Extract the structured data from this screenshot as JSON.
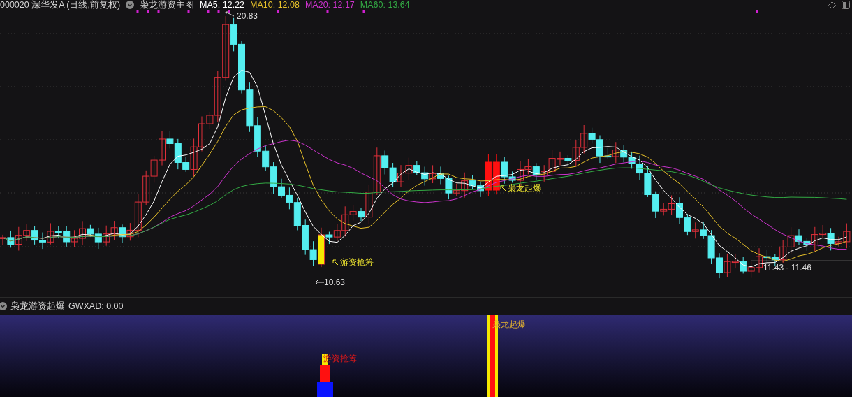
{
  "header": {
    "symbol": "000020 深华发A (日线,前复权)",
    "indicator": "枭龙游资主图",
    "ma": [
      {
        "label": "MA5: 12.22",
        "color": "#ffffff"
      },
      {
        "label": "MA10: 12.08",
        "color": "#e6c02a"
      },
      {
        "label": "MA20: 12.17",
        "color": "#cc33cc"
      },
      {
        "label": "MA60: 13.64",
        "color": "#33aa44"
      }
    ]
  },
  "main_chart": {
    "high_label": "20.83",
    "low_label": "10.63",
    "range_label": "11.43 - 11.46",
    "signals": [
      {
        "kind": "buy",
        "label": "游资抢筹"
      },
      {
        "kind": "breakout",
        "label": "枭龙起爆"
      }
    ]
  },
  "sub_panel": {
    "title": "枭龙游资起爆",
    "value": "GWXAD: 0.00",
    "signals": [
      {
        "kind": "buy",
        "label": "游资抢筹"
      },
      {
        "kind": "breakout",
        "label": "枭龙起爆"
      }
    ]
  }
}
